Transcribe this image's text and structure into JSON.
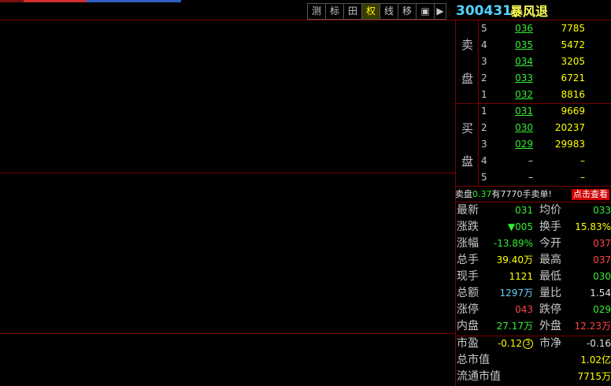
{
  "toolbar": {
    "buttons": [
      "测",
      "标",
      "田",
      "权",
      "线",
      "移",
      "▣",
      "▶"
    ]
  },
  "stock": {
    "code": "300431",
    "name": "暴风退"
  },
  "orderbook": {
    "sell_label_top": "卖",
    "sell_label_bottom": "盘",
    "buy_label_top": "买",
    "buy_label_bottom": "盘",
    "sell": [
      {
        "level": "5",
        "price": "036",
        "volume": "7785"
      },
      {
        "level": "4",
        "price": "035",
        "volume": "5472"
      },
      {
        "level": "3",
        "price": "034",
        "volume": "3205"
      },
      {
        "level": "2",
        "price": "033",
        "volume": "6721"
      },
      {
        "level": "1",
        "price": "032",
        "volume": "8816"
      }
    ],
    "buy": [
      {
        "level": "1",
        "price": "031",
        "volume": "9669"
      },
      {
        "level": "2",
        "price": "030",
        "volume": "20237"
      },
      {
        "level": "3",
        "price": "029",
        "volume": "29983"
      },
      {
        "level": "4",
        "price": "–",
        "volume": "–"
      },
      {
        "level": "5",
        "price": "–",
        "volume": "–"
      }
    ]
  },
  "notice": {
    "prefix": "卖盘",
    "price": "0.37",
    "text": "有7770手卖单!",
    "button": "点击查看"
  },
  "stats": [
    {
      "l1": "最新",
      "v1": "031",
      "c1": "green",
      "l2": "均价",
      "v2": "033",
      "c2": "green"
    },
    {
      "l1": "涨跌",
      "v1": "▼005",
      "c1": "green",
      "l2": "换手",
      "v2": "15.83%",
      "c2": "yellow"
    },
    {
      "l1": "涨幅",
      "v1": "-13.89%",
      "c1": "green",
      "l2": "今开",
      "v2": "037",
      "c2": "red"
    },
    {
      "l1": "总手",
      "v1": "39.40万",
      "c1": "yellow",
      "l2": "最高",
      "v2": "037",
      "c2": "red"
    },
    {
      "l1": "现手",
      "v1": "1121",
      "c1": "yellow",
      "l2": "最低",
      "v2": "030",
      "c2": "green"
    },
    {
      "l1": "总额",
      "v1": "1297万",
      "c1": "cyan",
      "l2": "量比",
      "v2": "1.54",
      "c2": "white"
    },
    {
      "l1": "涨停",
      "v1": "043",
      "c1": "red",
      "l2": "跌停",
      "v2": "029",
      "c2": "green"
    },
    {
      "l1": "内盘",
      "v1": "27.17万",
      "c1": "green",
      "l2": "外盘",
      "v2": "12.23万",
      "c2": "red"
    }
  ],
  "valuation": {
    "pe_label": "市盈",
    "pe_value": "-0.12",
    "pe_badge": "3",
    "pb_label": "市净",
    "pb_value": "-0.16",
    "mcap_label": "总市值",
    "mcap_value": "1.02亿",
    "float_label": "流通市值",
    "float_value": "7715万"
  }
}
